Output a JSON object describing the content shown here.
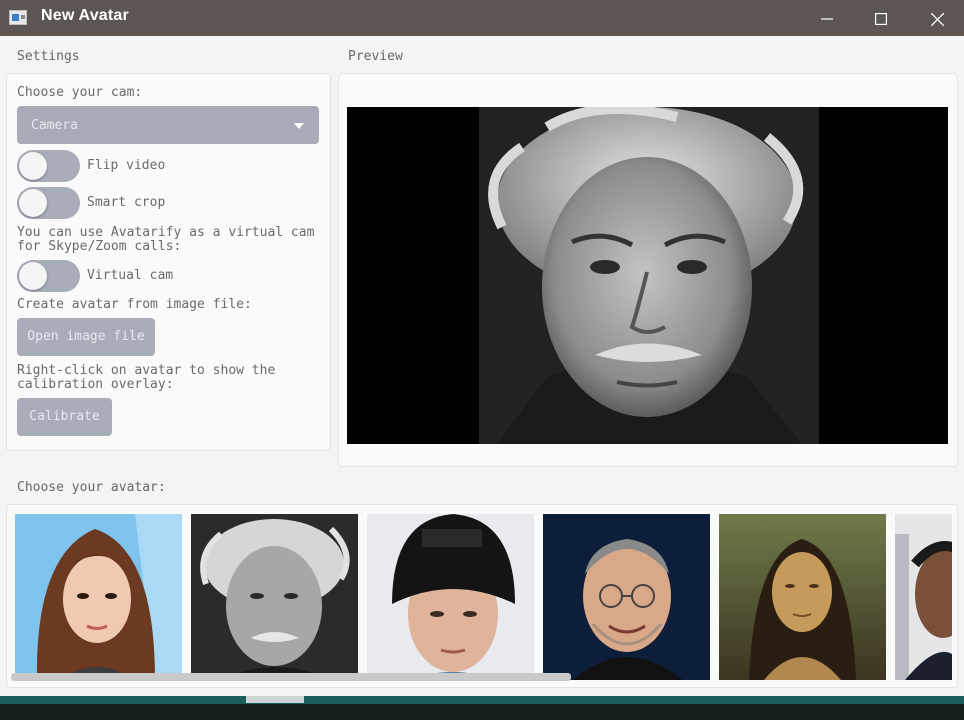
{
  "window": {
    "title": "New Avatar",
    "minimize_glyph": "—",
    "maximize_glyph": "☐",
    "close_glyph": "✕"
  },
  "settings": {
    "section_label": "Settings",
    "cam_label": "Choose your cam:",
    "cam_select_value": "Camera",
    "flip_video_label": "Flip video",
    "flip_video_on": false,
    "smart_crop_label": "Smart crop",
    "smart_crop_on": false,
    "virtual_cam_note": "You can use Avatarify as a virtual cam for Skype/Zoom calls:",
    "virtual_cam_label": "Virtual cam",
    "virtual_cam_on": false,
    "image_file_label": "Create avatar from image file:",
    "open_image_button": "Open image file",
    "calibrate_note": "Right-click on avatar to show the calibration overlay:",
    "calibrate_button": "Calibrate"
  },
  "preview": {
    "section_label": "Preview"
  },
  "avatars": {
    "section_label": "Choose your avatar:",
    "items": [
      "woman-portrait",
      "einstein-portrait",
      "eminem-portrait",
      "jobs-portrait",
      "mona-lisa-portrait",
      "obama-portrait"
    ]
  },
  "colors": {
    "titlebar": "#5d5551",
    "control": "#a9adb9",
    "panel_bg": "#fafafa",
    "window_bg": "#f4f4f4"
  }
}
